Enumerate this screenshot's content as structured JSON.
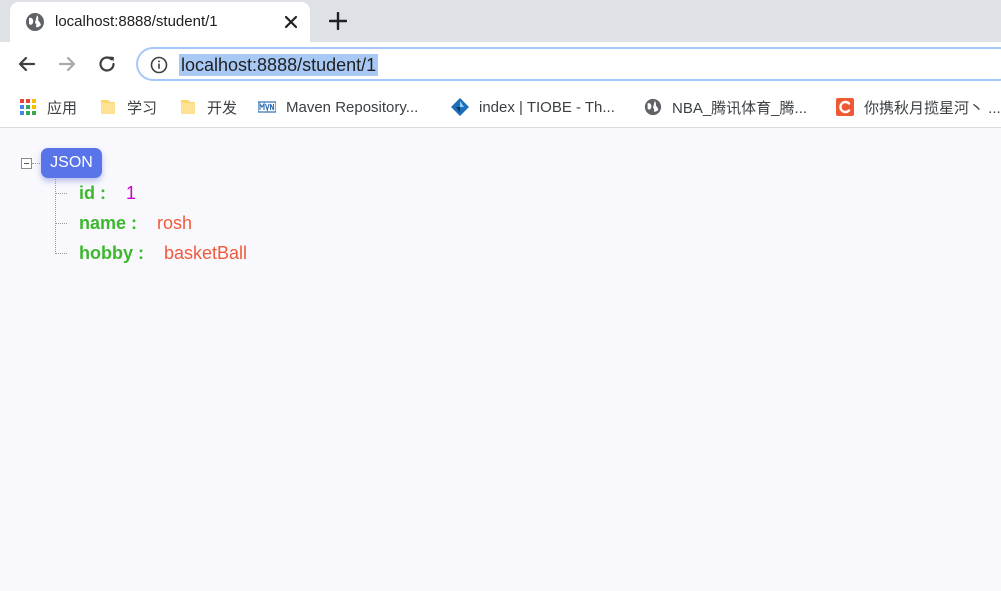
{
  "tab": {
    "title": "localhost:8888/student/1",
    "favicon_icon": "globe-icon",
    "close_icon": "close-icon",
    "new_tab_icon": "plus-icon"
  },
  "toolbar": {
    "back_icon": "arrow-left-icon",
    "forward_icon": "arrow-right-icon",
    "reload_icon": "reload-icon",
    "info_icon": "info-icon",
    "url": "localhost:8888/student/1"
  },
  "bookmarks": [
    {
      "label": "应用",
      "icon": "apps-grid-icon"
    },
    {
      "label": "学习",
      "icon": "folder-icon"
    },
    {
      "label": "开发",
      "icon": "folder-icon"
    },
    {
      "label": "Maven Repository...",
      "icon": "maven-icon"
    },
    {
      "label": "index | TIOBE - Th...",
      "icon": "tiobe-icon"
    },
    {
      "label": "NBA_腾讯体育_腾...",
      "icon": "globe-icon"
    },
    {
      "label": "你携秋月揽星河丶 ...",
      "icon": "csdn-icon"
    }
  ],
  "json_viewer": {
    "root_label": "JSON",
    "entries": [
      {
        "key": "id :",
        "value": "1",
        "type": "number"
      },
      {
        "key": "name :",
        "value": "rosh",
        "type": "string"
      },
      {
        "key": "hobby :",
        "value": "basketBall",
        "type": "string"
      }
    ]
  },
  "colors": {
    "accent_badge": "#5874e8",
    "key": "#3db82d",
    "number": "#c600cd",
    "string": "#f05a3c",
    "url_selection": "#a9c9f5"
  }
}
